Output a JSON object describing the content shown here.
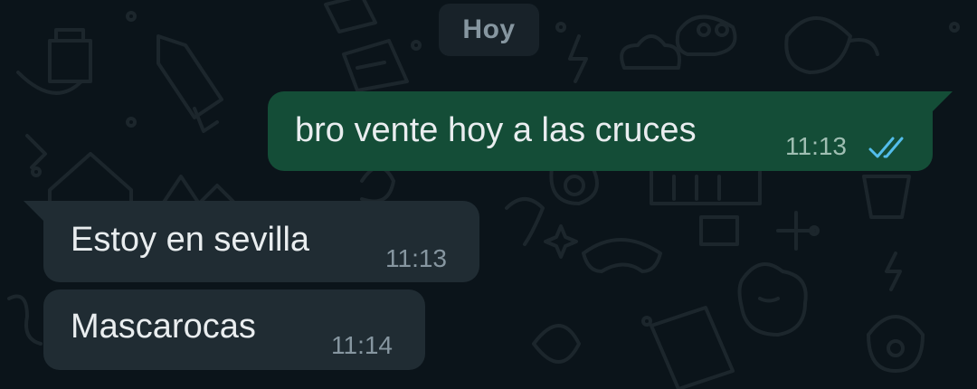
{
  "chat": {
    "date_separator": "Hoy",
    "messages": [
      {
        "direction": "outgoing",
        "text": "bro vente hoy a las cruces",
        "time": "11:13",
        "status": "read",
        "status_icon": "double-check-icon"
      },
      {
        "direction": "incoming",
        "text": "Estoy en sevilla",
        "time": "11:13"
      },
      {
        "direction": "incoming",
        "text": "Mascarocas",
        "time": "11:14"
      }
    ]
  },
  "colors": {
    "background": "#0b141a",
    "outgoing_bubble": "#144d37",
    "incoming_bubble": "#202c33",
    "date_chip": "#182229",
    "read_ticks": "#53bdeb",
    "text": "#e9edef",
    "muted_text": "#8696a0"
  }
}
